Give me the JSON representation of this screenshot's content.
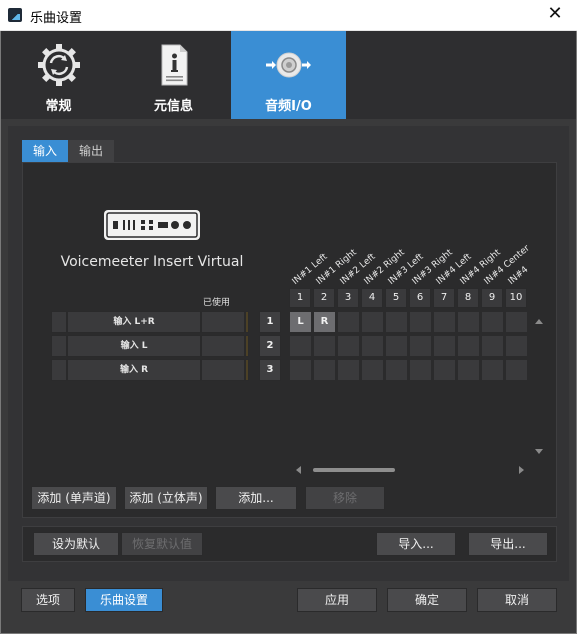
{
  "window": {
    "title": "乐曲设置",
    "close_glyph": "✕"
  },
  "top_tabs": [
    {
      "label": "常规",
      "icon": "gear-sync-icon"
    },
    {
      "label": "元信息",
      "icon": "document-info-icon"
    },
    {
      "label": "音频I/O",
      "icon": "audio-io-icon",
      "active": true
    }
  ],
  "io_tabs": [
    {
      "label": "输入",
      "active": true
    },
    {
      "label": "输出",
      "active": false
    }
  ],
  "device": {
    "name": "Voicemeeter Insert Virtual",
    "icon": "audio-interface-icon"
  },
  "matrix": {
    "used_label": "已使用",
    "channels": [
      "1",
      "2",
      "3",
      "4",
      "5",
      "6",
      "7",
      "8",
      "9",
      "10"
    ],
    "channel_names": [
      "IN#1 Left",
      "IN#1 Right",
      "IN#2 Left",
      "IN#2 Right",
      "IN#3 Left",
      "IN#3 Right",
      "IN#4 Left",
      "IN#4 Right",
      "IN#4 Center",
      "IN#4"
    ],
    "rows": [
      {
        "name": "输入 L+R",
        "number": "1",
        "assign": [
          "L",
          "R",
          "",
          "",
          "",
          "",
          "",
          "",
          "",
          ""
        ]
      },
      {
        "name": "输入 L",
        "number": "2",
        "assign": [
          "",
          "",
          "",
          "",
          "",
          "",
          "",
          "",
          "",
          ""
        ]
      },
      {
        "name": "输入 R",
        "number": "3",
        "assign": [
          "",
          "",
          "",
          "",
          "",
          "",
          "",
          "",
          "",
          ""
        ]
      }
    ]
  },
  "add_buttons": {
    "mono": "添加 (单声道)",
    "stereo": "添加 (立体声)",
    "add": "添加...",
    "remove": "移除"
  },
  "preset_buttons": {
    "set_default": "设为默认",
    "restore_default": "恢复默认值",
    "import": "导入...",
    "export": "导出..."
  },
  "footer": {
    "options": "选项",
    "song_settings": "乐曲设置",
    "apply": "应用",
    "ok": "确定",
    "cancel": "取消"
  },
  "colors": {
    "accent": "#3a8ed4",
    "background": "#3a3a3b",
    "panel": "#2b2b2c"
  }
}
